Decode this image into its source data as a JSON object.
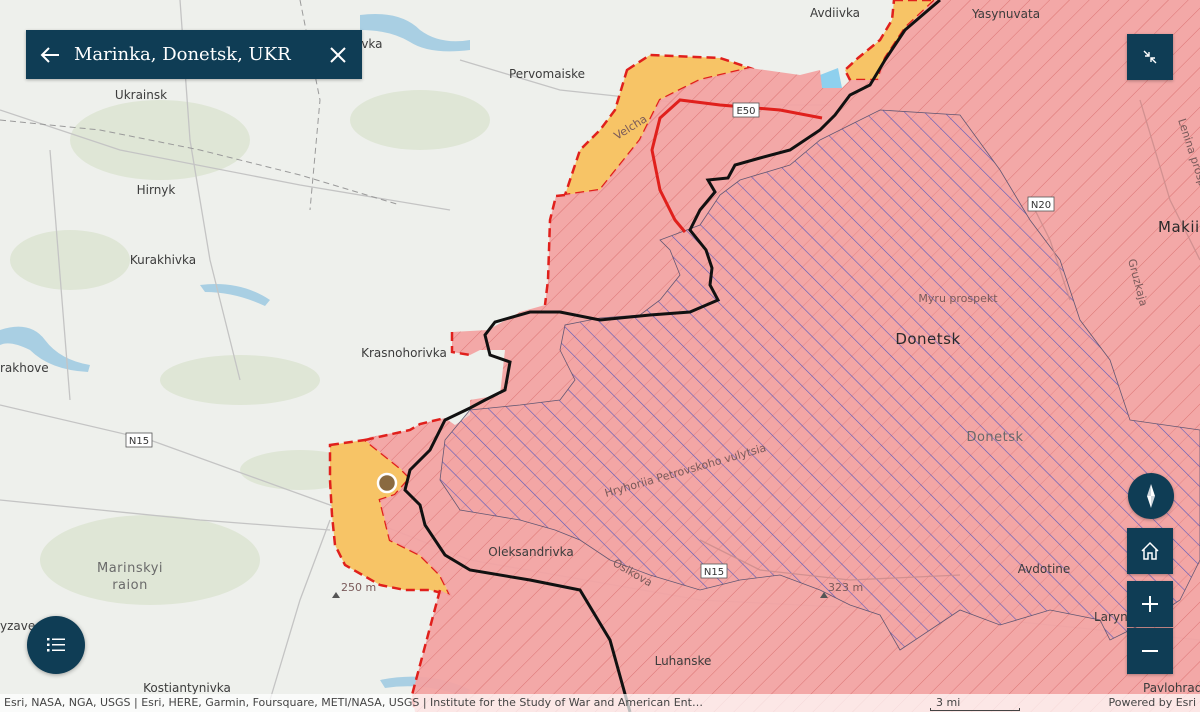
{
  "search": {
    "title": "Marinka, Donetsk, UKR"
  },
  "map": {
    "places": {
      "avdiivka": "Avdiivka",
      "yasynuvata": "Yasynuvata",
      "lenina": "Lenina prospekt",
      "pervomaiske": "Pervomaiske",
      "ukrainsk": "Ukrainsk",
      "ivka": "ivka",
      "hirnyk": "Hirnyk",
      "kurakhivka": "Kurakhivka",
      "makii": "Makii",
      "krasnohorivka": "Krasnohorivka",
      "donetsk_city": "Donetsk",
      "myru": "Myru prospekt",
      "donetsk_raion": "Donetsk",
      "rakhove": "rakhove",
      "petrovskoho": "Hryhoriia Petrovskoho vulytsia",
      "marinskyi_1": "Marinskyi",
      "marinskyi_2": "raion",
      "oleksandrivka": "Oleksandrivka",
      "oslkova": "Osikova",
      "avdotyne": "Avdotine",
      "larynka": "Laryn",
      "luhanske": "Luhanske",
      "kostiantynivka": "Kostiantynivka",
      "yzave": "yzave",
      "pavlohradske": "Pavlohradske",
      "velcha": "Velcha",
      "gruzkaja": "Gruzkaja"
    },
    "roads": {
      "e50": "E50",
      "n15_west": "N15",
      "n15_east": "N15",
      "n20": "N20"
    },
    "elevations": {
      "west": "250 m",
      "east": "323 m"
    },
    "colors": {
      "base": "#eef0ec",
      "occupied": "#f2a3a3",
      "contested": "#f7c466",
      "frontline": "#111111",
      "claimed_line": "#e0201c",
      "crimea_hatch": "#5058b8",
      "button": "#0f3d55"
    }
  },
  "controls": {
    "back_icon": "arrow-left-icon",
    "close_icon": "close-icon",
    "collapse_icon": "collapse-icon",
    "compass_icon": "compass-icon",
    "home_icon": "home-icon",
    "zoom_in_icon": "plus-icon",
    "zoom_out_icon": "minus-icon",
    "legend_icon": "list-icon"
  },
  "attribution": {
    "text": "Esri, NASA, NGA, USGS | Esri, HERE, Garmin, Foursquare, METI/NASA, USGS | Institute for the Study of War and American Ent…",
    "scale": "3 mi",
    "powered": "Powered by Esri"
  }
}
